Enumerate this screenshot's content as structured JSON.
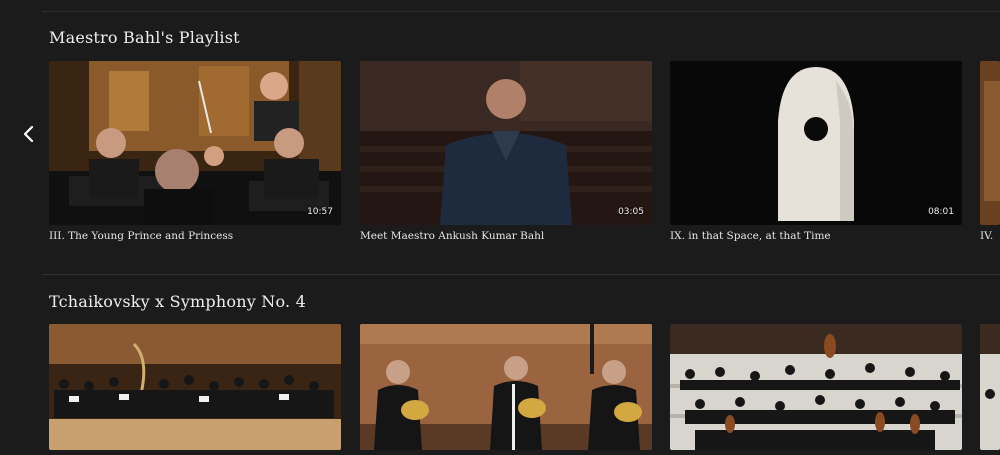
{
  "rows": [
    {
      "title": "Maestro Bahl's Playlist",
      "cards": [
        {
          "title": "III. The Young Prince and Princess",
          "duration": "10:57"
        },
        {
          "title": "Meet Maestro Ankush Kumar Bahl",
          "duration": "03:05"
        },
        {
          "title": "IX. in that Space, at that Time",
          "duration": "08:01"
        },
        {
          "title": "IV."
        }
      ]
    },
    {
      "title": "Tchaikovsky x Symphony No. 4",
      "cards": [
        {
          "title": ""
        },
        {
          "title": ""
        },
        {
          "title": ""
        },
        {
          "title": ""
        }
      ]
    }
  ],
  "nav": {
    "prev_icon": "chevron-left-icon"
  },
  "colors": {
    "background": "#1b1b1b",
    "text": "#eeeeee"
  }
}
